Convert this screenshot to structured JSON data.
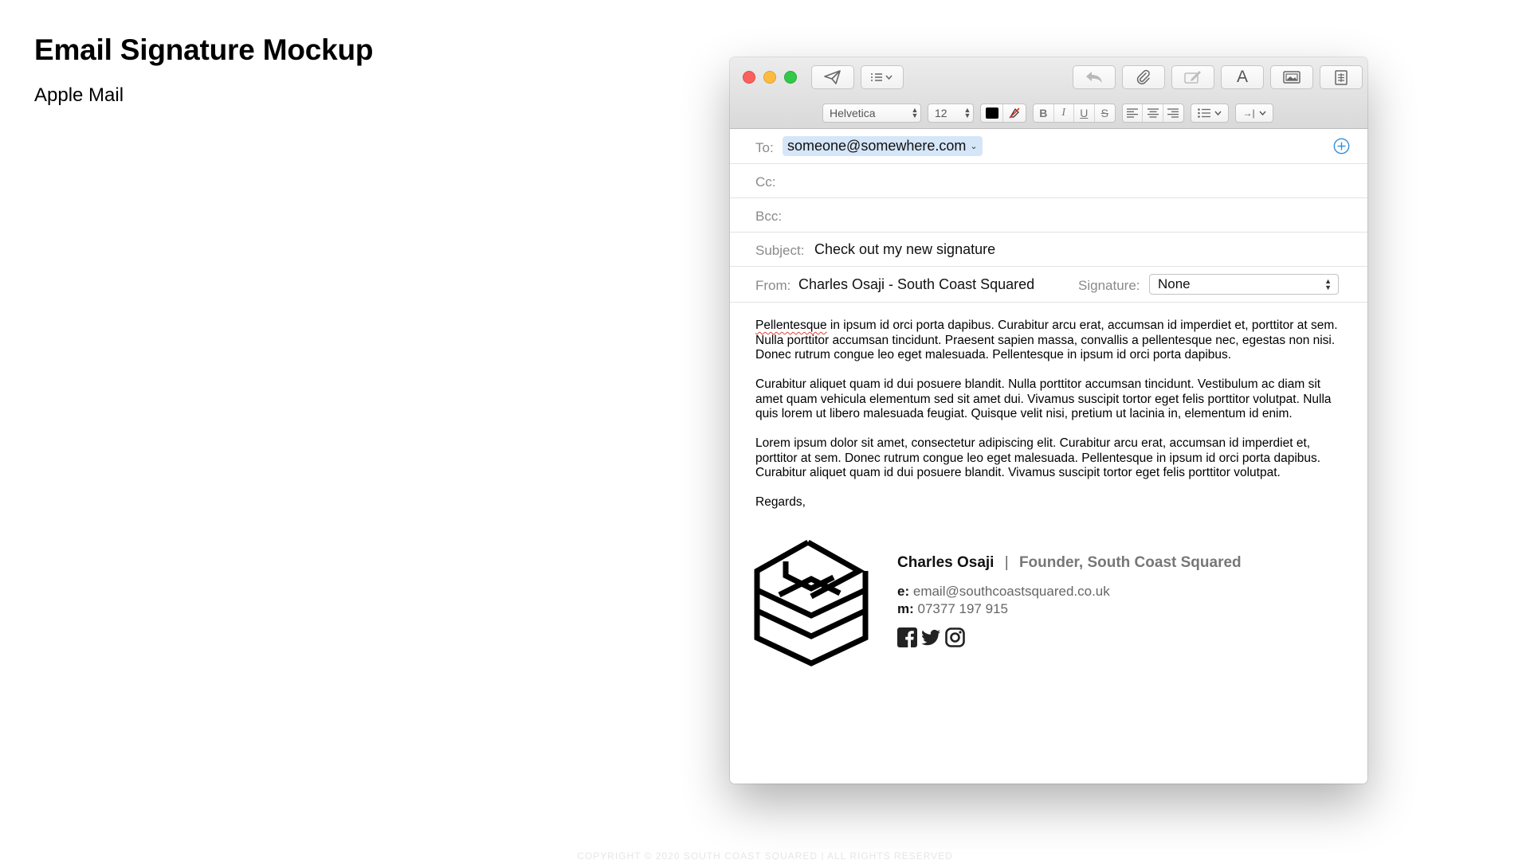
{
  "page": {
    "title": "Email Signature Mockup",
    "subtitle": "Apple Mail",
    "copyright": "COPYRIGHT © 2020 SOUTH COAST SQUARED | ALL RIGHTS RESERVED"
  },
  "toolbar": {
    "buttons": [
      "send-icon",
      "header-fields-icon",
      "reply-icon",
      "attach-icon",
      "markup-icon",
      "format-icon",
      "photo-browser-icon",
      "stationery-icon"
    ],
    "format_letter": "A"
  },
  "format_bar": {
    "font": "Helvetica",
    "size": "12",
    "bold": "B",
    "italic": "I",
    "underline": "U",
    "strike": "S",
    "indent": "→|"
  },
  "headers": {
    "to_label": "To:",
    "to_value": "someone@somewhere.com",
    "cc_label": "Cc:",
    "bcc_label": "Bcc:",
    "subject_label": "Subject:",
    "subject_value": "Check out my new signature",
    "from_label": "From:",
    "from_value": "Charles Osaji - South Coast Squared",
    "signature_label": "Signature:",
    "signature_value": "None"
  },
  "body": {
    "p1_misspelled": "Pellentesque",
    "p1_rest": " in ipsum id orci porta dapibus. Curabitur arcu erat, accumsan id imperdiet et, porttitor at sem. Nulla porttitor accumsan tincidunt. Praesent sapien massa, convallis a pellentesque nec, egestas non nisi. Donec rutrum congue leo eget malesuada. Pellentesque in ipsum id orci porta dapibus.",
    "p2": "Curabitur aliquet quam id dui posuere blandit. Nulla porttitor accumsan tincidunt. Vestibulum ac diam sit amet quam vehicula elementum sed sit amet dui. Vivamus suscipit tortor eget felis porttitor volutpat. Nulla quis lorem ut libero malesuada feugiat. Quisque velit nisi, pretium ut lacinia in, elementum id enim.",
    "p3": "Lorem ipsum dolor sit amet, consectetur adipiscing elit. Curabitur arcu erat, accumsan id imperdiet et, porttitor at sem. Donec rutrum congue leo eget malesuada. Pellentesque in ipsum id orci porta dapibus. Curabitur aliquet quam id dui posuere blandit. Vivamus suscipit tortor eget felis porttitor volutpat.",
    "closing": "Regards,"
  },
  "signature": {
    "name": "Charles Osaji",
    "separator": "|",
    "title": "Founder, South Coast Squared",
    "email_label": "e:",
    "email": "email@southcoastsquared.co.uk",
    "mobile_label": "m:",
    "mobile": "07377 197 915",
    "social": [
      "facebook-icon",
      "twitter-icon",
      "instagram-icon"
    ]
  },
  "colors": {
    "traffic_red": "#fc605c",
    "traffic_yellow": "#fdbc40",
    "traffic_green": "#34c84a",
    "token_bg": "#d5e6f8",
    "add_icon": "#2f8fe0"
  }
}
